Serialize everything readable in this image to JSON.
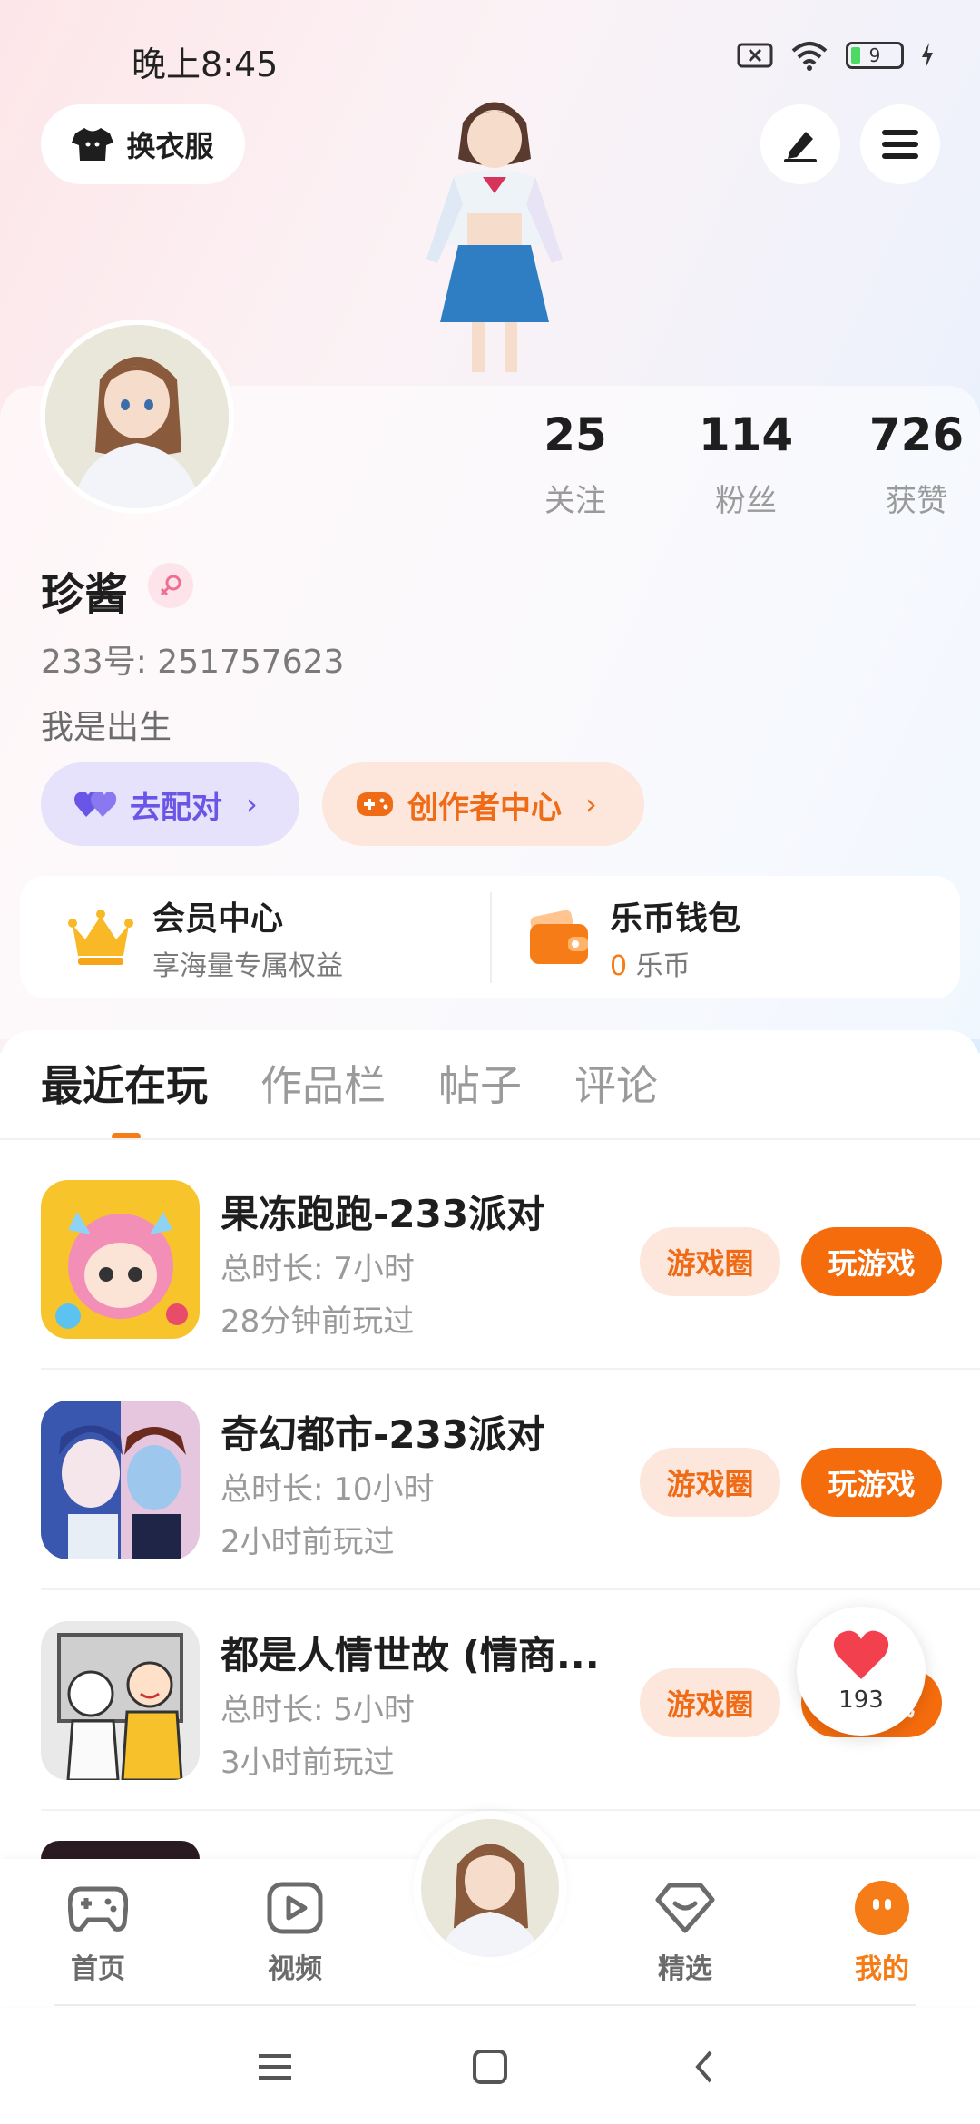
{
  "status_bar": {
    "time": "晚上8:45",
    "battery": "9"
  },
  "header": {
    "dress_label": "换衣服"
  },
  "profile": {
    "stats": [
      {
        "num": "25",
        "label": "关注"
      },
      {
        "num": "114",
        "label": "粉丝"
      },
      {
        "num": "726",
        "label": "获赞"
      }
    ],
    "nickname": "珍酱",
    "uid": "233号: 251757623",
    "bio": "我是出生",
    "match_label": "去配对",
    "creator_label": "创作者中心"
  },
  "wallet": {
    "vip_title": "会员中心",
    "vip_sub": "享海量专属权益",
    "coin_title": "乐币钱包",
    "coin_amount": "0",
    "coin_unit": "乐币"
  },
  "tabs": [
    "最近在玩",
    "作品栏",
    "帖子",
    "评论"
  ],
  "games": [
    {
      "name": "果冻跑跑-233派对",
      "duration": "总时长: 7小时",
      "last_played": "28分钟前玩过",
      "circle_label": "游戏圈",
      "play_label": "玩游戏"
    },
    {
      "name": "奇幻都市-233派对",
      "duration": "总时长: 10小时",
      "last_played": "2小时前玩过",
      "circle_label": "游戏圈",
      "play_label": "玩游戏"
    },
    {
      "name": "都是人情世故 (情商...",
      "duration": "总时长: 5小时",
      "last_played": "3小时前玩过",
      "circle_label": "游戏圈",
      "play_label": "玩游戏"
    }
  ],
  "fab": {
    "like_count": "193"
  },
  "bottom_nav": [
    {
      "label": "首页",
      "icon": "gamepad-icon"
    },
    {
      "label": "视频",
      "icon": "video-play-icon"
    },
    {
      "label": "精选",
      "icon": "heart-diamond-icon"
    },
    {
      "label": "我的",
      "icon": "smile-face-icon"
    }
  ],
  "colors": {
    "accent": "#f57c16",
    "play_button": "#f56c0c",
    "match_purple": "#6a56e6"
  }
}
